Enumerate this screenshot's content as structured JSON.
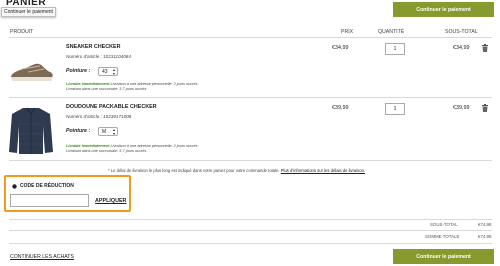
{
  "header": {
    "page_title": "PANIER",
    "tooltip": "Continuer le paiement",
    "pay_button": "Continuer le paiement"
  },
  "columns": {
    "product": "PRODUIT",
    "price": "PRIX",
    "quantity": "QUANTITÉ",
    "subtotal": "SOUS-TOTAL"
  },
  "items": [
    {
      "name": "SNEAKER CHECKER",
      "article": "Numéro d'article : 10231104084",
      "option_label": "Pointure :",
      "option_value": "43",
      "delivery_prefix": "Livrable immédiatement",
      "delivery_rest": " Livraison à une adresse personnelle: 2 jours ouvrés",
      "delivery_line2": "Livraison dans une succursale: 3-7 jours ouvrés",
      "price": "€34,99",
      "quantity": "1",
      "subtotal": "€34,99"
    },
    {
      "name": "DOUDOUNE PACKABLE CHECKER",
      "article": "Numéro d'article : 10238171008",
      "option_label": "Pointure :",
      "option_value": "M",
      "delivery_prefix": "Livrable immédiatement",
      "delivery_rest": " Livraison à une adresse personnelle: 2 jours ouvrés",
      "delivery_line2": "Livraison dans une succursale: 3-7 jours ouvrés",
      "price": "€39,99",
      "quantity": "1",
      "subtotal": "€39,99"
    }
  ],
  "note": {
    "text": "* Le délai de livraison le plus long est indiqué dans votre panier pour votre commande totale.",
    "link": "Plus d'informations sur les délais de livraison."
  },
  "discount": {
    "title": "CODE DE RÉDUCTION",
    "input_value": "",
    "apply": "APPLIQUER"
  },
  "totals": {
    "subtotal_label": "SOUS-TOTAL",
    "subtotal_value": "€74,98",
    "total_label": "SOMME TOTALE",
    "total_value": "€74,98"
  },
  "footer": {
    "continue_shopping": "CONTINUER LES ACHATS",
    "pay_button": "Continuer le paiement"
  },
  "colors": {
    "accent_green": "#869a2d",
    "highlight_orange": "#f29a1d",
    "in_stock_green": "#3a8a1a"
  }
}
